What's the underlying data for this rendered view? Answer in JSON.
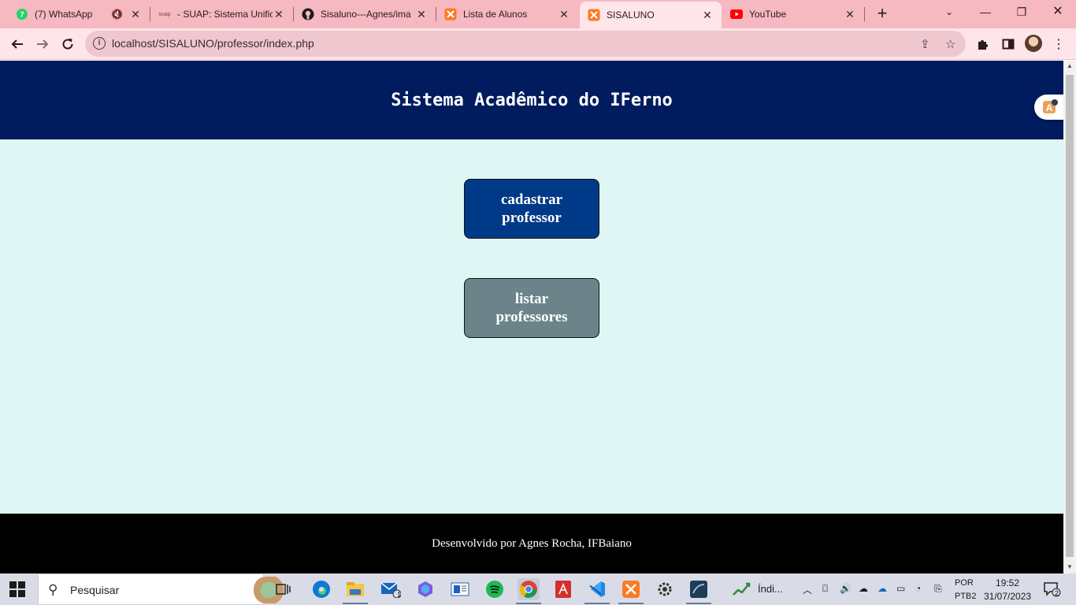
{
  "browser": {
    "tabs": [
      {
        "title": "(7) WhatsApp",
        "favicon": "whatsapp-icon",
        "muted": true
      },
      {
        "title": "- SUAP: Sistema Unific",
        "favicon": "suap-icon",
        "favicon_text": "suap"
      },
      {
        "title": "Sisaluno---Agnes/ima",
        "favicon": "github-icon"
      },
      {
        "title": "Lista de Alunos",
        "favicon": "xampp-icon"
      },
      {
        "title": "SISALUNO",
        "favicon": "xampp-icon",
        "active": true
      },
      {
        "title": "YouTube",
        "favicon": "youtube-icon"
      }
    ],
    "url": "localhost/SISALUNO/professor/index.php",
    "accent_color": "#f6b8c1"
  },
  "page": {
    "header_title": "Sistema Acadêmico do IFerno",
    "buttons": {
      "cadastrar": "cadastrar professor",
      "listar": "listar professores"
    },
    "footer_text": "Desenvolvido por Agnes Rocha, IFBaiano",
    "colors": {
      "header_bg": "#001c5e",
      "body_bg": "#dff7f4",
      "cadastrar_bg": "#003987",
      "listar_bg": "#6c838a",
      "footer_bg": "#000000"
    }
  },
  "taskbar": {
    "search_placeholder": "Pesquisar",
    "weather_label": "Índi...",
    "mail_badge": "1",
    "language": "POR",
    "layout": "PTB2",
    "time": "19:52",
    "date": "31/07/2023",
    "notification_count": "2"
  }
}
